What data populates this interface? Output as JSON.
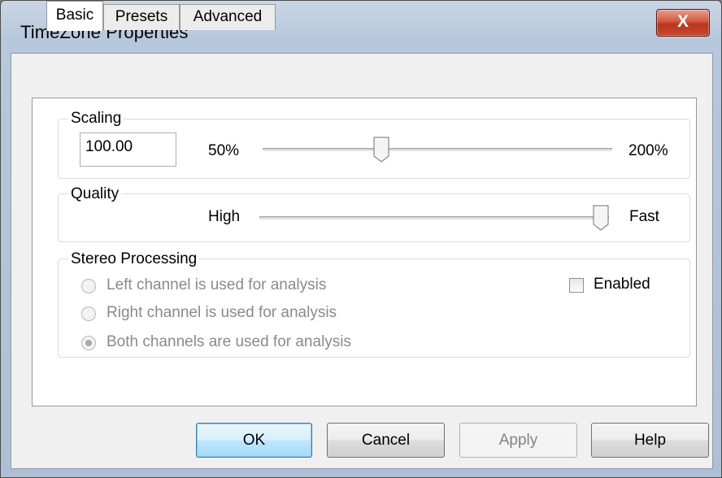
{
  "window": {
    "title": "TimeZone Properties",
    "close_label": "X"
  },
  "tabs": [
    {
      "label": "Basic",
      "active": true
    },
    {
      "label": "Presets",
      "active": false
    },
    {
      "label": "Advanced",
      "active": false
    }
  ],
  "scaling": {
    "group_label": "Scaling",
    "value": "100.00",
    "min_label": "50%",
    "max_label": "200%",
    "slider_position": 0.33
  },
  "quality": {
    "group_label": "Quality",
    "min_label": "High",
    "max_label": "Fast",
    "slider_position": 1.0
  },
  "stereo": {
    "group_label": "Stereo Processing",
    "options": [
      {
        "label": "Left channel is used for analysis",
        "checked": false,
        "enabled": false
      },
      {
        "label": "Right channel is used for analysis",
        "checked": false,
        "enabled": false
      },
      {
        "label": "Both channels are used for analysis",
        "checked": true,
        "enabled": false
      }
    ],
    "enabled_label": "Enabled",
    "enabled_checked": false
  },
  "buttons": {
    "ok": "OK",
    "cancel": "Cancel",
    "apply": "Apply",
    "help": "Help"
  },
  "colors": {
    "close_button": "#c8482c",
    "default_button": "#bee6fd",
    "disabled_text": "#8a8a8a"
  }
}
